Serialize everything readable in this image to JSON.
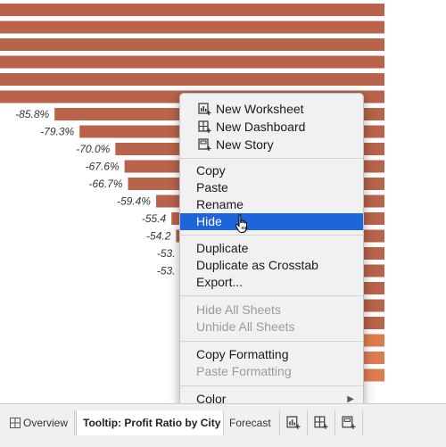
{
  "chart_data": {
    "type": "bar",
    "orientation": "horizontal",
    "bar_color": "#b8634a",
    "bar_color_light": "#dd7d4f",
    "values_shown": [
      "-85.8%",
      "-79.3%",
      "-70.0%",
      "-67.6%",
      "-66.7%",
      "-59.4%",
      "-55.4",
      "-54.2",
      "-53.",
      "-53."
    ],
    "values": [
      -100,
      -100,
      -100,
      -100,
      -100,
      -100,
      -85.8,
      -79.3,
      -70.0,
      -67.6,
      -66.7,
      -59.4,
      -55.4,
      -54.2,
      -53.0,
      -53.0,
      -52.0,
      -51.5,
      -51.0,
      -50.5,
      -50.0,
      -49.5
    ],
    "xlim": [
      -100,
      0
    ]
  },
  "menu": {
    "items": [
      {
        "id": "new-worksheet",
        "label": "New Worksheet",
        "icon": "new-worksheet-icon"
      },
      {
        "id": "new-dashboard",
        "label": "New Dashboard",
        "icon": "new-dashboard-icon"
      },
      {
        "id": "new-story",
        "label": "New Story",
        "icon": "new-story-icon"
      },
      {
        "id": "copy",
        "label": "Copy"
      },
      {
        "id": "paste",
        "label": "Paste"
      },
      {
        "id": "rename",
        "label": "Rename"
      },
      {
        "id": "hide",
        "label": "Hide",
        "selected": true
      },
      {
        "id": "duplicate",
        "label": "Duplicate"
      },
      {
        "id": "duplicate-crosstab",
        "label": "Duplicate as Crosstab"
      },
      {
        "id": "export",
        "label": "Export..."
      },
      {
        "id": "hide-all-sheets",
        "label": "Hide All Sheets",
        "disabled": true
      },
      {
        "id": "unhide-all-sheets",
        "label": "Unhide All Sheets",
        "disabled": true
      },
      {
        "id": "copy-formatting",
        "label": "Copy Formatting"
      },
      {
        "id": "paste-formatting",
        "label": "Paste Formatting",
        "disabled": true
      },
      {
        "id": "color",
        "label": "Color",
        "submenu": true
      }
    ],
    "selection_color": "#1e64db"
  },
  "tabs": {
    "overview": "Overview",
    "active": "Tooltip: Profit Ratio by City",
    "forecast": "Forecast",
    "buttons": [
      "new-worksheet-icon",
      "new-dashboard-icon",
      "new-story-icon"
    ]
  }
}
